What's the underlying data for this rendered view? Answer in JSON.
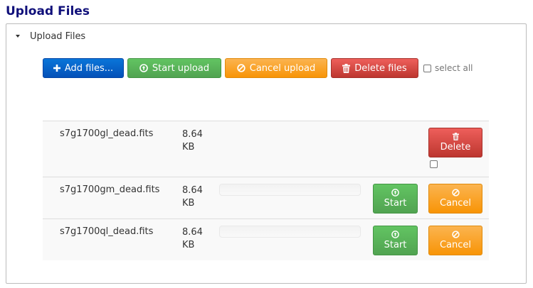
{
  "page": {
    "title": "Upload Files"
  },
  "panel": {
    "header": "Upload Files",
    "caret_icon": "caret-down-icon"
  },
  "toolbar": {
    "add_files": "Add files...",
    "start_upload": "Start upload",
    "cancel_upload": "Cancel upload",
    "delete_files": "Delete files",
    "select_all": "select all",
    "select_all_checked": false
  },
  "files": [
    {
      "name": "s7g1700gl_dead.fits",
      "size_value": "8.64",
      "size_unit": "KB",
      "delete_label": "Delete",
      "checked": false
    },
    {
      "name": "s7g1700gm_dead.fits",
      "size_value": "8.64",
      "size_unit": "KB",
      "progress": 0,
      "start_label": "Start",
      "cancel_label": "Cancel"
    },
    {
      "name": "s7g1700ql_dead.fits",
      "size_value": "8.64",
      "size_unit": "KB",
      "progress": 0,
      "start_label": "Start",
      "cancel_label": "Cancel"
    }
  ],
  "colors": {
    "title": "#10107a",
    "primary": "#0451b8",
    "success": "#51a351",
    "warning": "#f89406",
    "danger": "#bd362f"
  }
}
